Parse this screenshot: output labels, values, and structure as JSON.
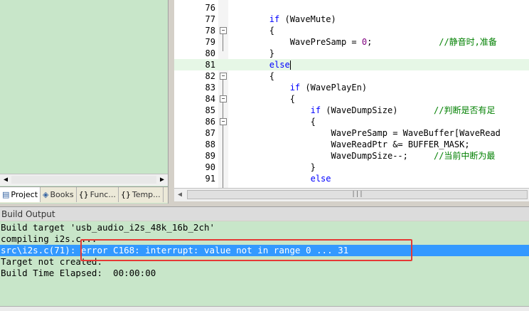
{
  "project_panel": {
    "tabs": [
      {
        "label": "Project",
        "icon": "project-icon"
      },
      {
        "label": "Books",
        "icon": "books-icon"
      },
      {
        "label": "Func...",
        "icon": "functions-icon"
      },
      {
        "label": "Temp...",
        "icon": "templates-icon"
      }
    ]
  },
  "editor": {
    "lines": [
      {
        "num": "76",
        "fold": "",
        "code": ""
      },
      {
        "num": "77",
        "fold": "",
        "code": "        if (WaveMute)"
      },
      {
        "num": "78",
        "fold": "−",
        "code": "        {"
      },
      {
        "num": "79",
        "fold": "",
        "code": "            WavePreSamp = 0;             //静音时,准备"
      },
      {
        "num": "80",
        "fold": "",
        "code": "        }"
      },
      {
        "num": "81",
        "fold": "",
        "code": "        else"
      },
      {
        "num": "82",
        "fold": "−",
        "code": "        {"
      },
      {
        "num": "83",
        "fold": "",
        "code": "            if (WavePlayEn)"
      },
      {
        "num": "84",
        "fold": "−",
        "code": "            {"
      },
      {
        "num": "85",
        "fold": "",
        "code": "                if (WaveDumpSize)       //判断是否有足"
      },
      {
        "num": "86",
        "fold": "−",
        "code": "                {"
      },
      {
        "num": "87",
        "fold": "",
        "code": "                    WavePreSamp = WaveBuffer[WaveRead"
      },
      {
        "num": "88",
        "fold": "",
        "code": "                    WaveReadPtr &= BUFFER_MASK;"
      },
      {
        "num": "89",
        "fold": "",
        "code": "                    WaveDumpSize--;     //当前中断为最"
      },
      {
        "num": "90",
        "fold": "",
        "code": "                }"
      },
      {
        "num": "91",
        "fold": "",
        "code": "                else"
      }
    ]
  },
  "build_output": {
    "title": "Build Output",
    "lines": [
      "Build target 'usb_audio_i2s_48k_16b_2ch'",
      "compiling i2s.c...",
      "src\\i2s.c(71): error C168: interrupt: value not in range 0 ... 31",
      "Target not created.",
      "Build Time Elapsed:  00:00:00"
    ]
  },
  "colors": {
    "panel_green": "#c8e6c9",
    "selection_blue": "#3399ff",
    "highlight_box": "#e53935"
  }
}
